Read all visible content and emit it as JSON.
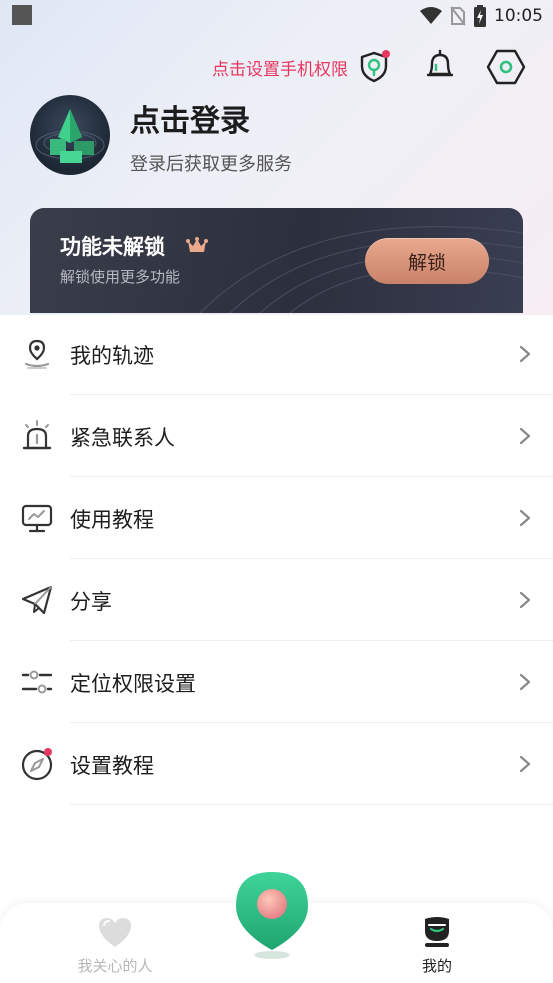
{
  "status_bar": {
    "time": "10:05"
  },
  "header": {
    "permission_link": "点击设置手机权限",
    "login_title": "点击登录",
    "login_subtitle": "登录后获取更多服务"
  },
  "unlock_card": {
    "title": "功能未解锁",
    "subtitle": "解锁使用更多功能",
    "button_label": "解锁"
  },
  "menu": {
    "items": [
      {
        "label": "我的轨迹",
        "icon": "location-pin-icon"
      },
      {
        "label": "紧急联系人",
        "icon": "alarm-light-icon"
      },
      {
        "label": "使用教程",
        "icon": "monitor-chart-icon"
      },
      {
        "label": "分享",
        "icon": "paper-plane-icon"
      },
      {
        "label": "定位权限设置",
        "icon": "sliders-icon"
      },
      {
        "label": "设置教程",
        "icon": "compass-icon"
      }
    ]
  },
  "tabbar": {
    "care_label": "我关心的人",
    "mine_label": "我的"
  },
  "colors": {
    "accent_pink": "#e8375f",
    "accent_green": "#2ec27e",
    "card_dark": "#2c2f3d",
    "button_copper": "#d99179"
  }
}
